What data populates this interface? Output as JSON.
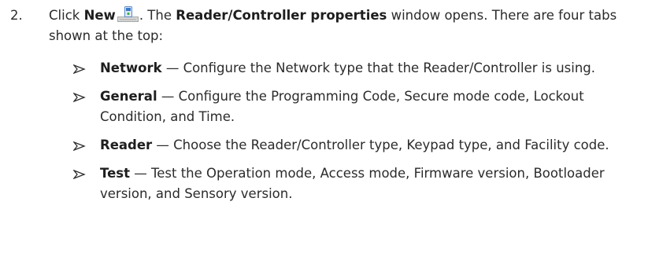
{
  "step": {
    "number": "2.",
    "part1": "Click ",
    "new_label": "New",
    "part2": ". The ",
    "window_name": "Reader/Controller properties",
    "part3": " window opens. There are four tabs shown at the top:",
    "icon": "new-device-icon"
  },
  "tabs": [
    {
      "name": "Network",
      "description": " — Configure the Network type that the Reader/Controller is using."
    },
    {
      "name": "General",
      "description": " — Configure the Programming Code, Secure mode code, Lockout Condition, and Time."
    },
    {
      "name": "Reader",
      "description": " — Choose the Reader/Controller type, Keypad type, and Facility code."
    },
    {
      "name": "Test",
      "description": " — Test the Operation mode, Access mode, Firmware version, Bootloader version, and Sensory version."
    }
  ],
  "bullet_icon": "arrow-bullet-icon",
  "colors": {
    "text": "#2b2b2b",
    "icon_blue": "#3a78c8",
    "icon_gray": "#b9b9b9"
  }
}
